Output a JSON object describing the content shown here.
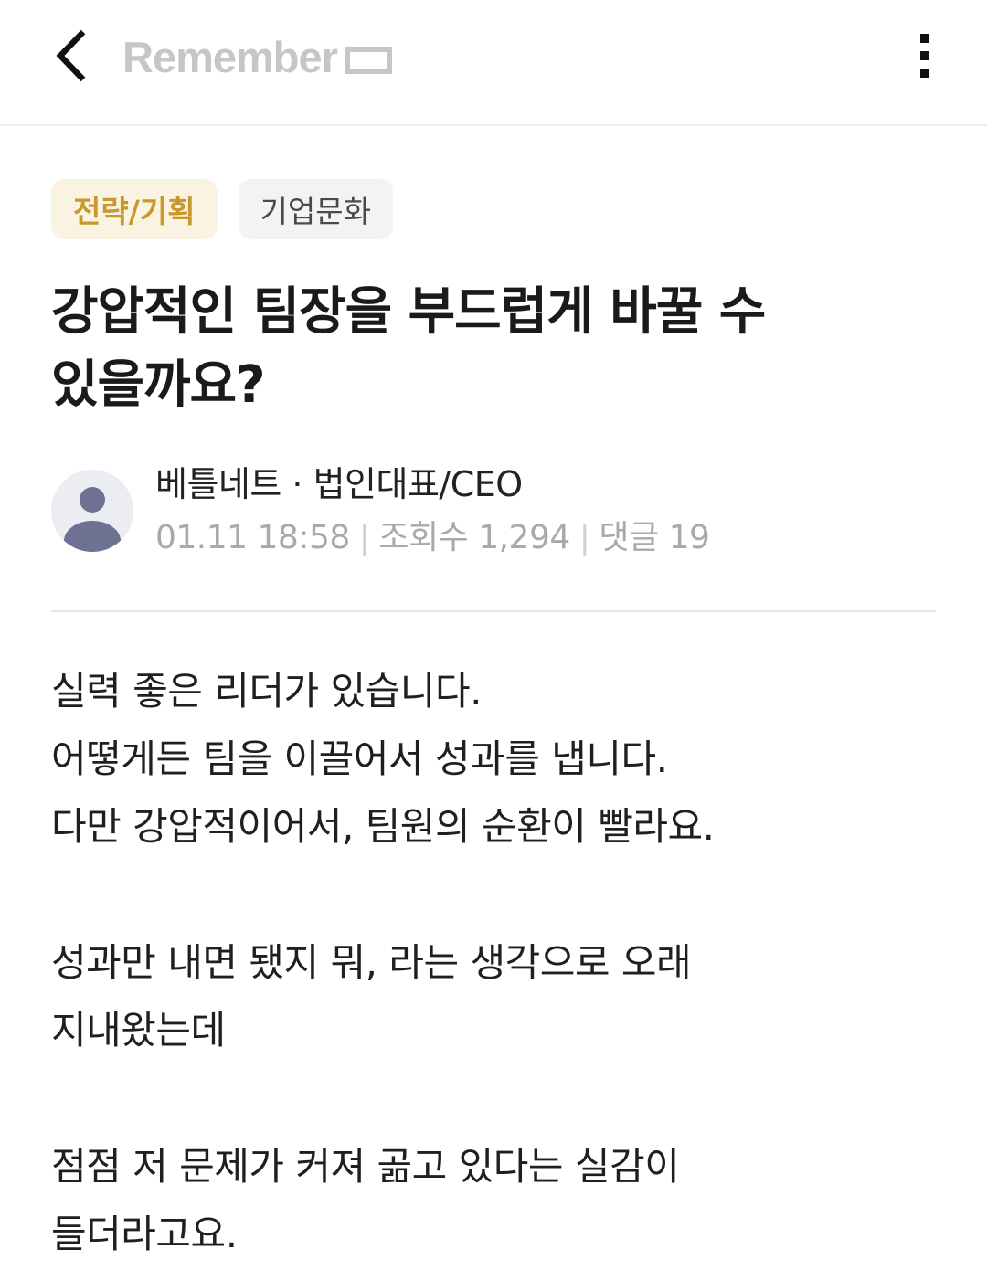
{
  "header": {
    "logo_text": "Remember",
    "back_icon": "chevron-left-icon",
    "menu_icon": "kebab-menu-icon"
  },
  "tags": [
    {
      "label": "전략/기획",
      "color": "#c9982b"
    },
    {
      "label": "기업문화",
      "color": "#4a4a4a"
    }
  ],
  "post": {
    "title_line1": "강압적인 팀장을 부드럽게 바꿀 수",
    "title_line2": "있을까요?",
    "author": "베틀네트 · 법인대표/CEO",
    "date": "01.11 18:58",
    "views_label": "조회수 1,294",
    "comments_label": "댓글 19",
    "body": {
      "p1": [
        "실력 좋은 리더가 있습니다.",
        "어떻게든 팀을 이끌어서 성과를 냅니다.",
        "다만 강압적이어서, 팀원의 순환이 빨라요."
      ],
      "p2": [
        "성과만 내면 됐지 뭐, 라는 생각으로 오래",
        "지내왔는데"
      ],
      "p3": [
        "점점 저 문제가 커져 곪고 있다는 실감이",
        "들더라고요."
      ]
    }
  },
  "colors": {
    "accent_tag": "#c9982b",
    "avatar_bg": "#ececf3",
    "avatar_fg": "#6e7191"
  }
}
